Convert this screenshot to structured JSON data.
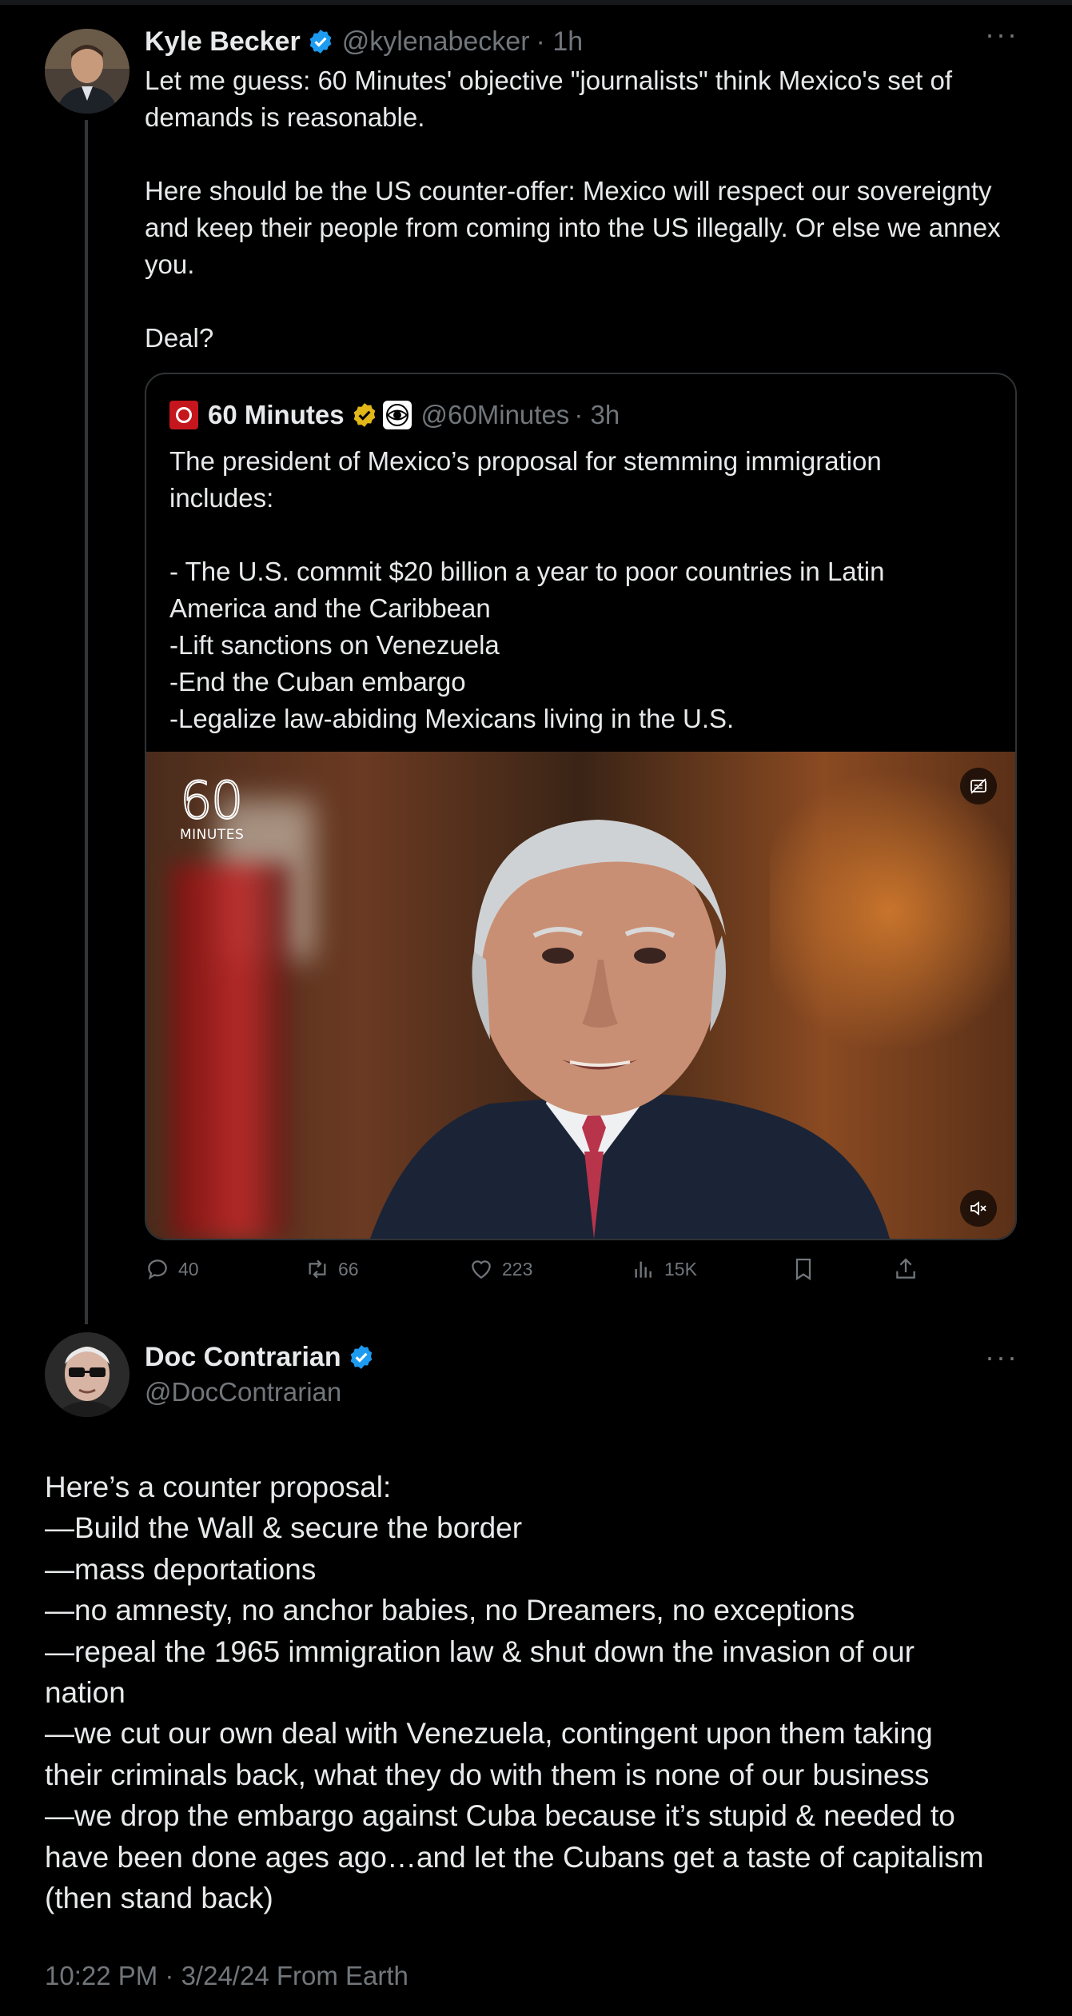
{
  "main_tweet": {
    "author": {
      "name": "Kyle Becker",
      "handle": "@kylenabecker",
      "time": "· 1h",
      "verified": true
    },
    "paragraphs": [
      "Let me guess: 60 Minutes' objective \"journalists\" think Mexico's set of demands is reasonable.",
      "Here should be the US counter-offer: Mexico will respect our sovereignty and keep their people from coming into the US illegally. Or else we annex you.",
      "Deal?"
    ],
    "quote": {
      "author": {
        "name": "60 Minutes",
        "handle": "@60Minutes",
        "time": "· 3h"
      },
      "paragraphs": [
        "The president of Mexico’s proposal for stemming immigration includes:",
        "- The U.S. commit $20 billion a year to poor countries in Latin America and the Caribbean\n-Lift sanctions on Venezuela\n-End the Cuban embargo\n-Legalize law-abiding Mexicans living in the U.S."
      ],
      "media": {
        "logo_number": "60",
        "logo_text": "MINUTES",
        "kind": "video"
      }
    },
    "stats": {
      "replies": "40",
      "reposts": "66",
      "likes": "223",
      "views": "15K"
    }
  },
  "reply_tweet": {
    "author": {
      "name": "Doc Contrarian",
      "handle": "@DocContrarian",
      "verified": true
    },
    "lines": [
      "Here’s a counter proposal:",
      "—Build the Wall & secure the border",
      "—mass deportations",
      "—no amnesty, no anchor babies, no Dreamers, no exceptions",
      "—repeal the 1965 immigration law & shut down the invasion of our",
      "nation",
      "—we cut our own deal with Venezuela, contingent upon them taking",
      "their criminals back, what they do with them is none of our business",
      "—we drop the embargo against Cuba because it’s stupid & needed to",
      "have been done ages ago…and let the Cubans get a taste of capitalism",
      "(then stand back)"
    ],
    "timestamp": "10:22 PM · 3/24/24 From Earth"
  },
  "colors": {
    "background": "#000000",
    "text": "#e7e9ea",
    "secondary": "#71767b",
    "verified_blue": "#1d9bf0",
    "verified_gold": "#e2b719",
    "border": "#2f3336"
  },
  "icons": [
    "more-icon",
    "verified-badge-icon",
    "reply-icon",
    "repost-icon",
    "like-icon",
    "views-icon",
    "bookmark-icon",
    "share-icon",
    "mute-icon",
    "captions-icon"
  ]
}
